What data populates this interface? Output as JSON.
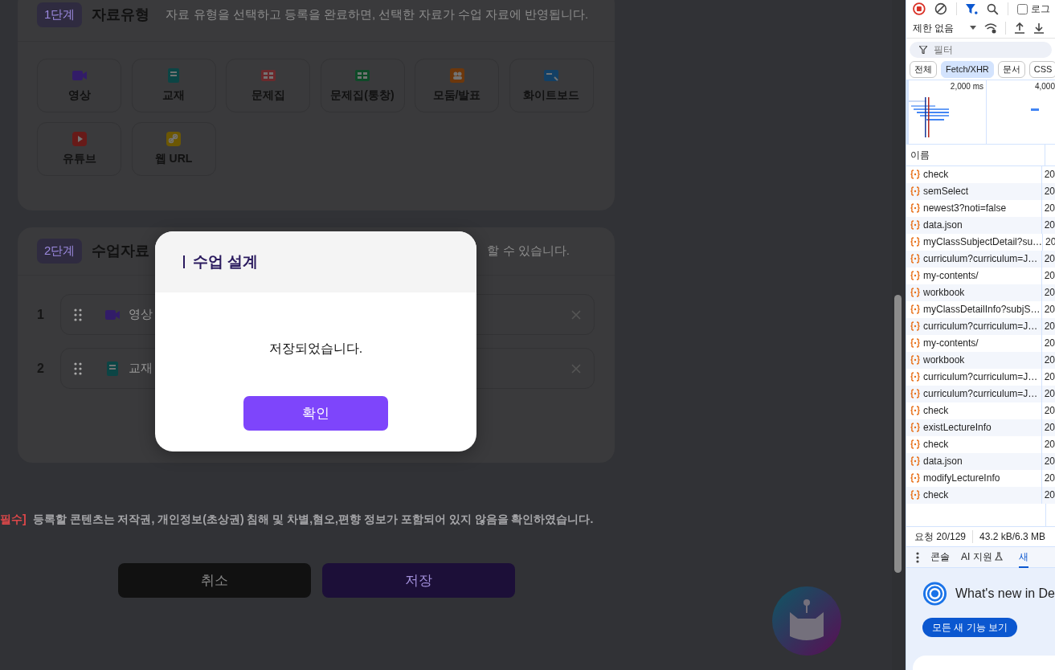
{
  "page": {
    "step1": {
      "badge": "1단계",
      "title": "자료유형",
      "description": "자료 유형을 선택하고 등록을 완료하면, 선택한 자료가 수업 자료에 반영됩니다.",
      "types": [
        {
          "label": "영상",
          "kind": "video"
        },
        {
          "label": "교재",
          "kind": "book"
        },
        {
          "label": "문제집",
          "kind": "workbook"
        },
        {
          "label": "문제집(통창)",
          "kind": "workbook2"
        },
        {
          "label": "모둠/발표",
          "kind": "group"
        },
        {
          "label": "화이트보드",
          "kind": "board"
        },
        {
          "label": "유튜브",
          "kind": "youtube"
        },
        {
          "label": "웹 URL",
          "kind": "link"
        }
      ]
    },
    "step2": {
      "badge": "2단계",
      "title": "수업자료",
      "description": "할 수 있습니다.",
      "items": [
        {
          "number": "1",
          "label": "영상",
          "kind": "video"
        },
        {
          "number": "2",
          "label": "교재",
          "kind": "book"
        }
      ]
    },
    "consent": {
      "tag": "필수]",
      "text": "등록할 콘텐츠는 저작권, 개인정보(초상권) 침해 및 차별,혐오,편향 정보가 포함되어 있지 않음을 확인하였습니다."
    },
    "buttons": [
      {
        "label": "취소",
        "kind": "cancel"
      },
      {
        "label": "저장",
        "kind": "save"
      }
    ]
  },
  "dialog": {
    "title": "수업 설계",
    "message": "저장되었습니다.",
    "button": "확인"
  },
  "devtools": {
    "preserve_log": {
      "label": "로그",
      "checked": false
    },
    "throttle": "제한 없음",
    "filter": {
      "placeholder": "필터"
    },
    "chips": [
      {
        "label": "전체",
        "selected": false
      },
      {
        "label": "Fetch/XHR",
        "selected": true
      },
      {
        "label": "문서",
        "selected": false
      },
      {
        "label": "CSS",
        "selected": false
      }
    ],
    "overview_ticks": [
      "2,000 ms",
      "4,000"
    ],
    "columns": [
      "이름"
    ],
    "requests": [
      {
        "name": "check",
        "status": "20"
      },
      {
        "name": "semSelect",
        "status": "20"
      },
      {
        "name": "newest3?noti=false",
        "status": "20"
      },
      {
        "name": "data.json",
        "status": "20"
      },
      {
        "name": "myClassSubjectDetail?su…",
        "status": "20"
      },
      {
        "name": "curriculum?curriculum=J…",
        "status": "20"
      },
      {
        "name": "my-contents/",
        "status": "20"
      },
      {
        "name": "workbook",
        "status": "20"
      },
      {
        "name": "myClassDetailInfo?subjS…",
        "status": "20"
      },
      {
        "name": "curriculum?curriculum=J…",
        "status": "20"
      },
      {
        "name": "my-contents/",
        "status": "20"
      },
      {
        "name": "workbook",
        "status": "20"
      },
      {
        "name": "curriculum?curriculum=J…",
        "status": "20"
      },
      {
        "name": "curriculum?curriculum=J…",
        "status": "20"
      },
      {
        "name": "check",
        "status": "20"
      },
      {
        "name": "existLectureInfo",
        "status": "20"
      },
      {
        "name": "check",
        "status": "20"
      },
      {
        "name": "data.json",
        "status": "20"
      },
      {
        "name": "modifyLectureInfo",
        "status": "20"
      },
      {
        "name": "check",
        "status": "20"
      }
    ],
    "summary": [
      "요청 20/129",
      "43.2 kB/6.3 MB"
    ],
    "drawer_tabs": [
      {
        "label": "콘솔",
        "kind": "plain",
        "selected": false
      },
      {
        "label": "AI 지원",
        "kind": "flask",
        "selected": false
      },
      {
        "label": "새",
        "kind": "plain",
        "selected": true
      }
    ],
    "whats_new": {
      "title": "What's new in De",
      "button": "모든 새 기능 보기"
    }
  }
}
